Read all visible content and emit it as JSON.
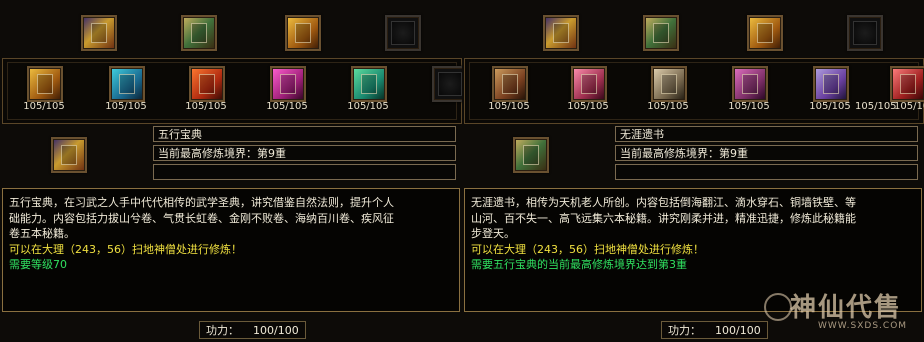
{
  "left_panel": {
    "counts": [
      "105/105",
      "105/105",
      "105/105",
      "105/105",
      "105/105"
    ],
    "skill_name": "五行宝典",
    "realm_line": "当前最高修炼境界：第9重",
    "extra_line": "",
    "description_lines": [
      "五行宝典，在习武之人手中代代相传的武学圣典，讲究借鉴自然法则，提升个人",
      "础能力。内容包括力拔山兮卷、气贯长虹卷、金刚不败卷、海纳百川卷、疾风征",
      "卷五本秘籍。"
    ],
    "location_line": "可以在大理（243，56）扫地神僧处进行修炼！",
    "requirement_line": "需要等级70",
    "gongli_label": "功力：",
    "gongli_value": "100/100"
  },
  "right_panel": {
    "counts": [
      "105/105",
      "105/105",
      "105/105",
      "105/105",
      "105/105",
      "105/105",
      "105/10"
    ],
    "skill_name": "无涯遗书",
    "realm_line": "当前最高修炼境界：第9重",
    "extra_line": "",
    "description_lines": [
      "无涯遗书，相传为天机老人所创。内容包括倒海翻江、滴水穿石、铜墙铁壁、等",
      "山河、百不失一、高飞远集六本秘籍。讲究刚柔并进，精准迅捷，修炼此秘籍能",
      "步登天。"
    ],
    "location_line": "可以在大理（243，56）扫地神僧处进行修炼！",
    "requirement_line": "需要五行宝典的当前最高修炼境界达到第3重",
    "gongli_label": "功力：",
    "gongli_value": "100/100"
  },
  "watermark": {
    "title": "神仙代售",
    "url": "WWW.SXDS.COM"
  }
}
